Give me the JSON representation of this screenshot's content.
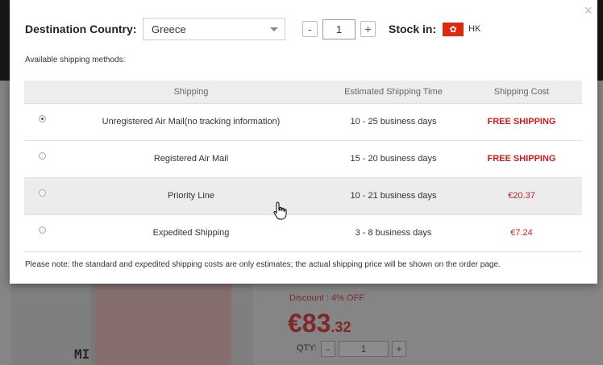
{
  "modal": {
    "close_label": "×",
    "destination_label": "Destination Country:",
    "country_value": "Greece",
    "qty_minus": "-",
    "qty_value": "1",
    "qty_plus": "+",
    "stock_label": "Stock in:",
    "stock_region": "HK",
    "flag_glyph": "✿",
    "available_label": "Available shipping methods:",
    "headers": {
      "shipping": "Shipping",
      "time": "Estimated Shipping Time",
      "cost": "Shipping Cost"
    },
    "methods": [
      {
        "name": "Unregistered Air Mail(no tracking information)",
        "time": "10 - 25 business days",
        "cost": "FREE SHIPPING",
        "selected": true
      },
      {
        "name": "Registered Air Mail",
        "time": "15 - 20 business days",
        "cost": "FREE SHIPPING",
        "selected": false
      },
      {
        "name": "Priority Line",
        "time": "10 - 21 business days",
        "cost": "€20.37",
        "selected": false
      },
      {
        "name": "Expedited Shipping",
        "time": "3 - 8 business days",
        "cost": "€7.24",
        "selected": false
      }
    ],
    "note": "Please note: the standard and expedited shipping costs are only estimates; the actual shipping price will be shown on the order page."
  },
  "background": {
    "discount": "Discount : 4% OFF",
    "price_main": "€83",
    "price_cents": ".32",
    "qty_label": "QTY:",
    "qty_minus": "-",
    "qty_value": "1",
    "qty_plus": "+",
    "brand_mark": "MI"
  },
  "colors": {
    "accent_red": "#c81e1e",
    "flag_red": "#de2910"
  }
}
